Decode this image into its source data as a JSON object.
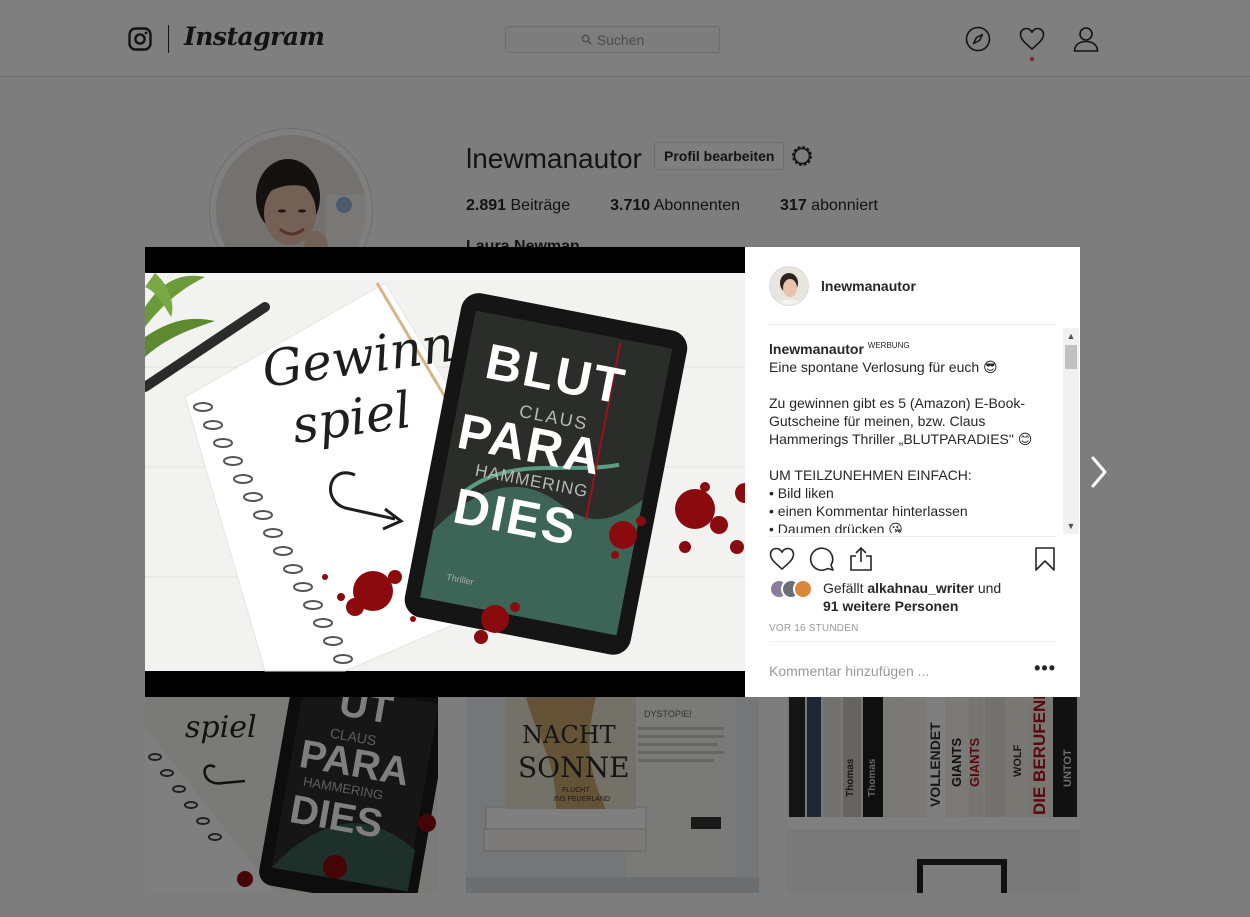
{
  "topbar": {
    "brand": "Instagram",
    "search_placeholder": "Suchen"
  },
  "profile": {
    "username": "lnewmanautor",
    "edit_label": "Profil bearbeiten",
    "stats": [
      {
        "value": "2.891",
        "label": "Beiträge"
      },
      {
        "value": "3.710",
        "label": "Abonnenten"
      },
      {
        "value": "317",
        "label": "abonniert"
      }
    ],
    "fullname": "Laura Newman"
  },
  "post": {
    "author": "lnewmanautor",
    "caption_author": "lnewmanautor",
    "caption_tag": "WERBUNG",
    "caption_lines": [
      "Eine spontane Verlosung für euch 😎",
      "",
      "Zu gewinnen gibt es 5 (Amazon) E-Book-Gutscheine für meinen, bzw. Claus Hammerings Thriller „BLUTPARADIES\" 😊",
      "",
      "UM TEILZUNEHMEN EINFACH:",
      "• Bild liken",
      "• einen Kommentar hinterlassen",
      "• Daumen drücken 😘"
    ],
    "likes_prefix": "Gefällt",
    "likes_user": "alkahnau_writer",
    "likes_and": "und",
    "likes_others": "91 weitere Personen",
    "timestamp": "VOR 16 STUNDEN",
    "comment_placeholder": "Kommentar hinzufügen ...",
    "image_text": {
      "gewinn": "Gewinn",
      "spiel": "spiel",
      "blut": "BLUT",
      "claus": "CLAUS",
      "para": "PARA",
      "hammering": "HAMMERING",
      "dies": "DIES",
      "thriller": "Thriller"
    }
  },
  "grid": {
    "item1": {
      "spiel": "spiel",
      "blut": "UT",
      "claus": "CLAUS",
      "para": "PARA",
      "hammering": "HAMMERING",
      "dies": "DIES"
    },
    "item2": {
      "nacht": "NACHT",
      "sonne": "SONNE",
      "flucht": "FLUCHT",
      "ins": "INS FEUERLAND",
      "dystopie": "DYSTOPIE!"
    },
    "item3": {
      "spines": [
        "Thomas",
        "Thomas",
        "VOLLENDET",
        "GIANTS",
        "GIANTS",
        "WOLF",
        "DIE BERUFENE",
        "UNTOT"
      ]
    }
  },
  "colors": {
    "blood": "#8b0a0e",
    "leaf": "#3f6f5f",
    "like_red": "#ed4956"
  }
}
